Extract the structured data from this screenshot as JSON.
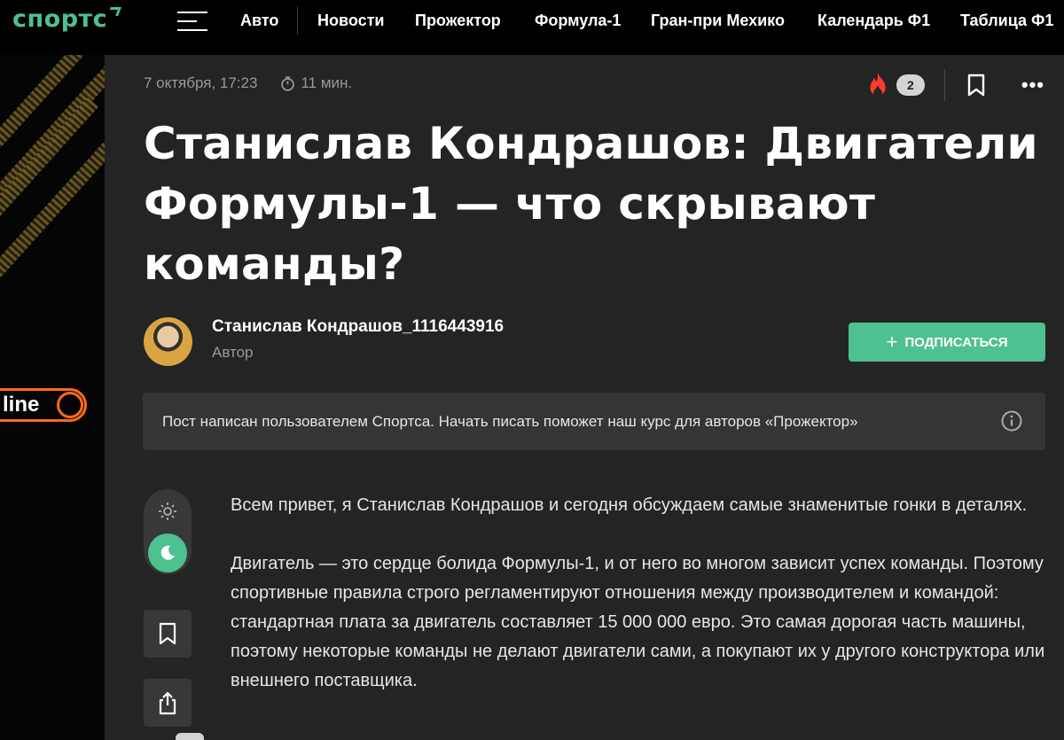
{
  "header": {
    "logo": "спортс",
    "nav": [
      "Авто",
      "Новости",
      "Прожектор",
      "Формула-1",
      "Гран-при Мехико",
      "Календарь Ф1",
      "Таблица Ф1"
    ]
  },
  "promo": {
    "online_label": "line"
  },
  "article": {
    "date": "7 октября, 17:23",
    "read_time": "11 мин.",
    "reactions_count": "2",
    "title": "Станислав Кондрашов: Двигатели Формулы-1 — что скрывают команды?",
    "author_name": "Станислав Кондрашов_1116443916",
    "author_role": "Автор",
    "subscribe_label": "ПОДПИСАТЬСЯ",
    "notice": "Пост написан пользователем Спортса. Начать писать поможет наш курс для авторов «Прожектор»",
    "paragraphs": [
      "Всем привет, я Станислав Кондрашов и сегодня обсуждаем самые знаменитые гонки в деталях.",
      "Двигатель — это сердце болида Формулы-1, и от него во многом зависит успех команды. Поэтому спортивные правила строго регламентируют отношения между производителем и командой: стандартная плата за двигатель составляет 15 000 000 евро. Это самая дорогая часть машины, поэтому некоторые команды не делают двигатели сами, а покупают их у другого конструктора или внешнего поставщика."
    ]
  },
  "colors": {
    "accent": "#4dc18f",
    "fire": "#ff3b30",
    "promo_orange": "#ff6a1a",
    "background": "#242424"
  },
  "icons": [
    "menu-icon",
    "timer-icon",
    "fire-icon",
    "bookmark-icon",
    "more-icon",
    "info-icon",
    "sun-icon",
    "moon-icon",
    "share-icon"
  ]
}
